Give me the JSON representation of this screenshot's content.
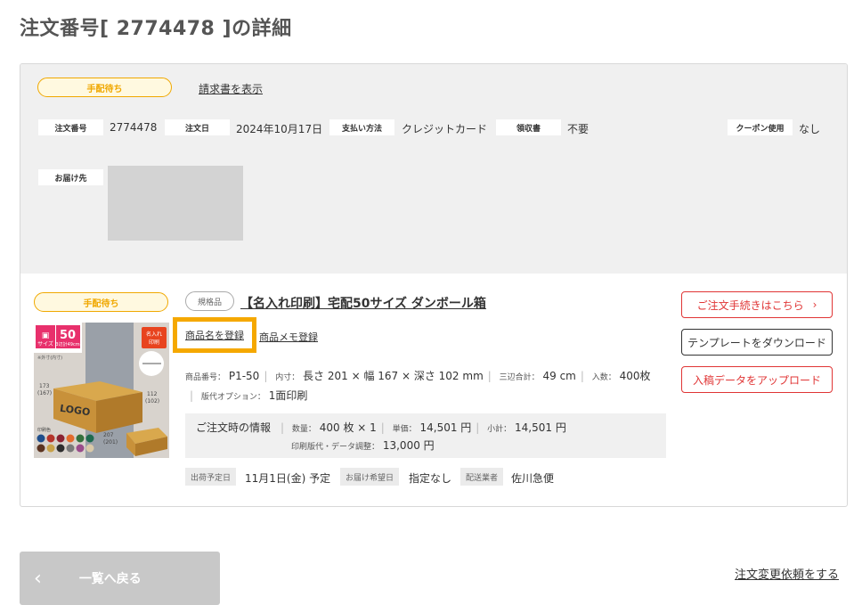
{
  "page": {
    "title": "注文番号[ 2774478 ]の詳細"
  },
  "summary": {
    "status_badge": "手配待ち",
    "invoice_link": "請求書を表示",
    "fields": {
      "order_no_label": "注文番号",
      "order_no_value": "2774478",
      "order_date_label": "注文日",
      "order_date_value": "2024年10月17日",
      "payment_label": "支払い方法",
      "payment_value": "クレジットカード",
      "receipt_label": "領収書",
      "receipt_value": "不要",
      "coupon_label": "クーポン使用",
      "coupon_value": "なし",
      "ship_to_label": "お届け先"
    }
  },
  "item": {
    "status_badge": "手配待ち",
    "type_badge": "規格品",
    "title": "【名入れ印刷】宅配50サイズ ダンボール箱",
    "register_name_link": "商品名を登録",
    "register_memo_link": "商品メモ登録",
    "image": {
      "size_num": "50",
      "size_word": "サイズ",
      "sum_text": "3辺計49cm",
      "named_badge_1": "名入れ",
      "named_badge_2": "印刷",
      "logo_text": "LOGO",
      "dim_left": "173",
      "dim_left_sub": "(167)",
      "dim_right": "112",
      "dim_right_sub": "(102)",
      "dim_bottom": "207",
      "dim_bottom_sub": "(201)",
      "note_text": "※外寸(内寸)",
      "color_label": "印刷色",
      "swatch_colors": [
        "#1f4e8c",
        "#b5352b",
        "#8b2332",
        "#e36c2c",
        "#35713d",
        "#1e6b4f",
        "#5b3320",
        "#c8a24a",
        "#2d2d2d",
        "#7a7a7a",
        "#9a4c8b",
        "#d9c9a8"
      ]
    },
    "specs": {
      "code_label": "商品番号：",
      "code_value": "P1-50",
      "inner_label": "内寸：",
      "inner_value": "長さ 201 × 幅 167 × 深さ 102 mm",
      "sum_label": "三辺合計：",
      "sum_value": "49 cm",
      "qty_label": "入数：",
      "qty_value": "400枚",
      "plate_label": "版代オプション：",
      "plate_value": "1面印刷"
    },
    "order_info": {
      "heading": "ご注文時の情報",
      "qty_label": "数量：",
      "qty_value": "400 枚 × 1",
      "unit_label": "単価：",
      "unit_value": "14,501 円",
      "subtotal_label": "小計：",
      "subtotal_value": "14,501 円",
      "plate_label": "印刷版代・データ調整：",
      "plate_value": "13,000 円"
    },
    "shipping": {
      "ship_date_label": "出荷予定日",
      "ship_date_value": "11月1日(金) 予定",
      "delivery_label": "お届け希望日",
      "delivery_value": "指定なし",
      "carrier_label": "配送業者",
      "carrier_value": "佐川急便"
    },
    "buttons": {
      "procedure": "ご注文手続きはこちら",
      "template": "テンプレートをダウンロード",
      "upload": "入稿データをアップロード"
    }
  },
  "footer": {
    "back_label": "一覧へ戻る",
    "change_link": "注文変更依頼をする"
  }
}
